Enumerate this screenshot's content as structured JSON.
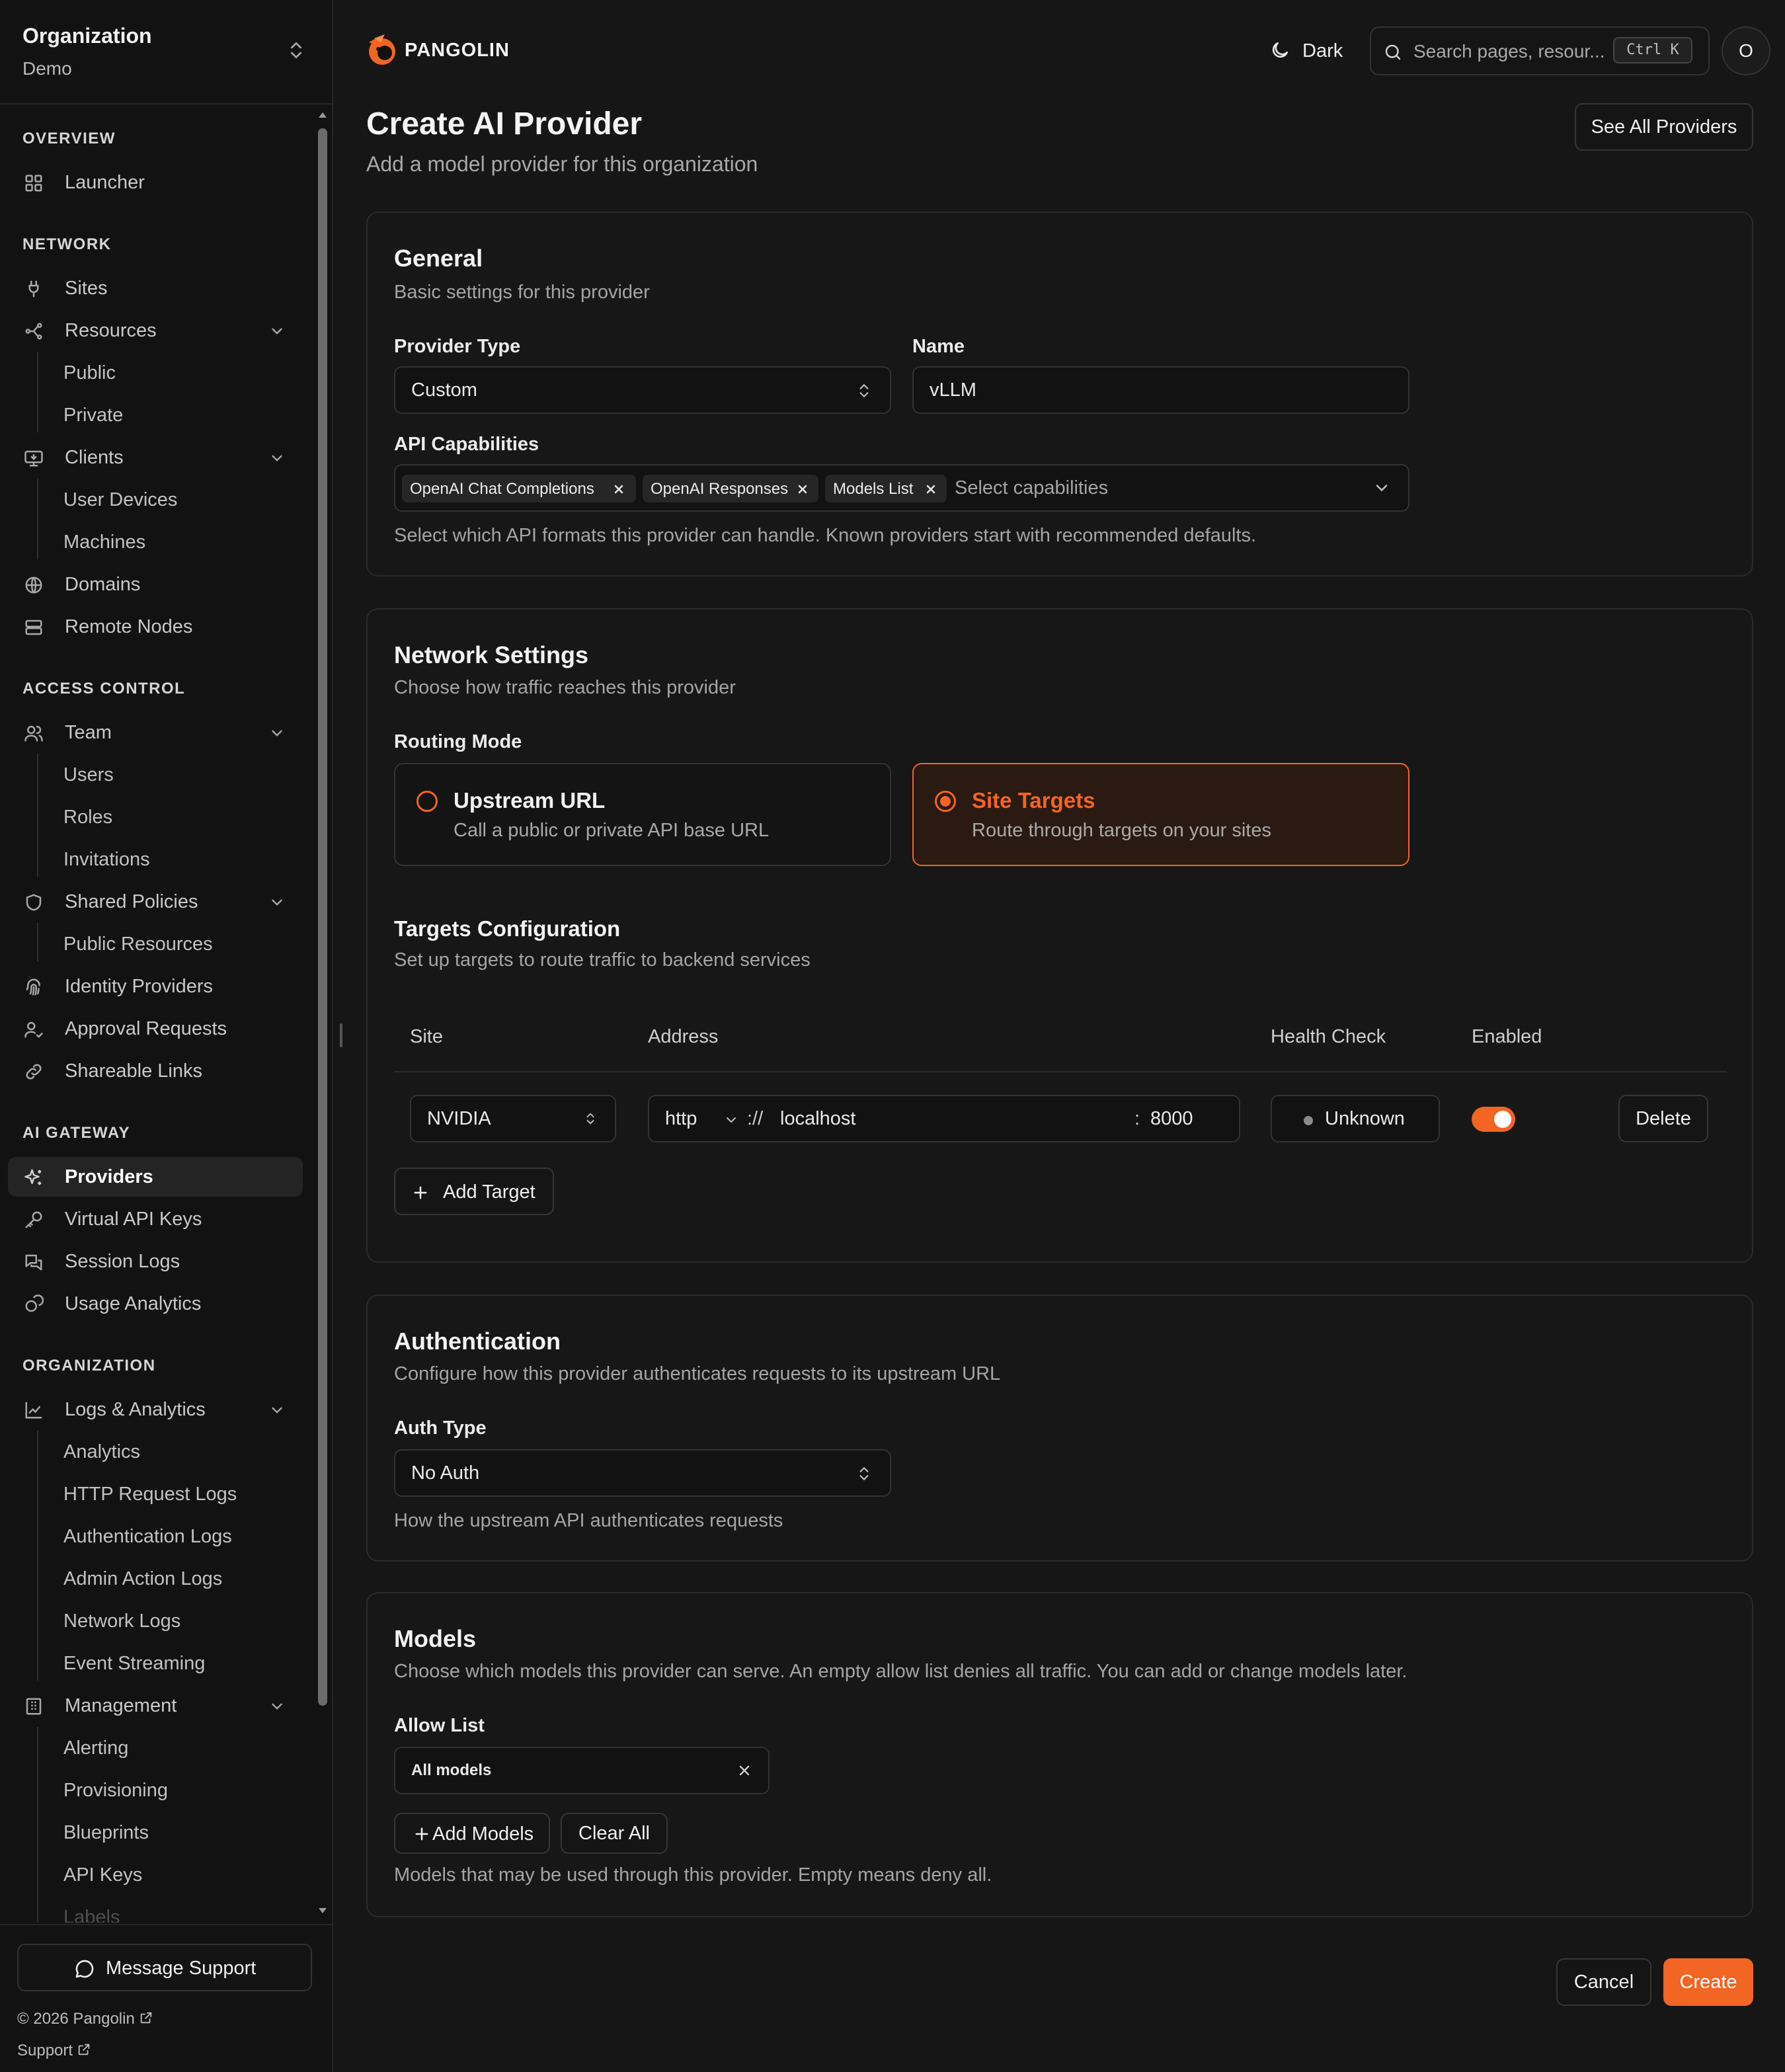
{
  "org": {
    "title": "Organization",
    "name": "Demo"
  },
  "nav": {
    "overview": "OVERVIEW",
    "launcher": "Launcher",
    "network": "NETWORK",
    "sites": "Sites",
    "resources": "Resources",
    "resources_public": "Public",
    "resources_private": "Private",
    "clients": "Clients",
    "clients_user_devices": "User Devices",
    "clients_machines": "Machines",
    "domains": "Domains",
    "remote_nodes": "Remote Nodes",
    "access_control": "ACCESS CONTROL",
    "team": "Team",
    "team_users": "Users",
    "team_roles": "Roles",
    "team_invitations": "Invitations",
    "shared_policies": "Shared Policies",
    "shared_public_resources": "Public Resources",
    "identity_providers": "Identity Providers",
    "approval_requests": "Approval Requests",
    "shareable_links": "Shareable Links",
    "ai_gateway": "AI GATEWAY",
    "providers": "Providers",
    "virtual_api_keys": "Virtual API Keys",
    "session_logs": "Session Logs",
    "usage_analytics": "Usage Analytics",
    "organization": "ORGANIZATION",
    "logs_analytics": "Logs & Analytics",
    "logs_analytics_analytics": "Analytics",
    "logs_http": "HTTP Request Logs",
    "logs_auth": "Authentication Logs",
    "logs_admin": "Admin Action Logs",
    "logs_network": "Network Logs",
    "logs_event_streaming": "Event Streaming",
    "management": "Management",
    "mgmt_alerting": "Alerting",
    "mgmt_provisioning": "Provisioning",
    "mgmt_blueprints": "Blueprints",
    "mgmt_api_keys": "API Keys",
    "mgmt_labels": "Labels"
  },
  "footer": {
    "message_support": "Message Support",
    "copyright": "© 2026 Pangolin",
    "support": "Support"
  },
  "topbar": {
    "brand": "PANGOLIN",
    "theme": "Dark",
    "search_placeholder": "Search pages, resour...",
    "search_shortcut": "Ctrl K",
    "avatar_initial": "O"
  },
  "page": {
    "title": "Create AI Provider",
    "subtitle": "Add a model provider for this organization",
    "see_all": "See All Providers"
  },
  "general": {
    "title": "General",
    "subtitle": "Basic settings for this provider",
    "provider_type_label": "Provider Type",
    "provider_type_value": "Custom",
    "name_label": "Name",
    "name_value": "vLLM",
    "capabilities_label": "API Capabilities",
    "capabilities": [
      "OpenAI Chat Completions",
      "OpenAI Responses",
      "Models List"
    ],
    "capabilities_placeholder": "Select capabilities",
    "capabilities_help": "Select which API formats this provider can handle. Known providers start with recommended defaults."
  },
  "network": {
    "title": "Network Settings",
    "subtitle": "Choose how traffic reaches this provider",
    "routing_label": "Routing Mode",
    "upstream_title": "Upstream URL",
    "upstream_desc": "Call a public or private API base URL",
    "site_title": "Site Targets",
    "site_desc": "Route through targets on your sites",
    "selected_mode": "Site Targets",
    "targets_title": "Targets Configuration",
    "targets_subtitle": "Set up targets to route traffic to backend services",
    "columns": {
      "site": "Site",
      "address": "Address",
      "health": "Health Check",
      "enabled": "Enabled"
    },
    "target": {
      "site": "NVIDIA",
      "scheme": "http",
      "separator": "://",
      "host": "localhost",
      "port_sep": ":",
      "port": "8000",
      "health": "Unknown",
      "enabled": true,
      "delete": "Delete"
    },
    "add_target": "Add Target"
  },
  "auth": {
    "title": "Authentication",
    "subtitle": "Configure how this provider authenticates requests to its upstream URL",
    "type_label": "Auth Type",
    "type_value": "No Auth",
    "help": "How the upstream API authenticates requests"
  },
  "models": {
    "title": "Models",
    "subtitle": "Choose which models this provider can serve. An empty allow list denies all traffic. You can add or change models later.",
    "allow_label": "Allow List",
    "allow_chip": "All models",
    "add_models": "Add Models",
    "clear_all": "Clear All",
    "help": "Models that may be used through this provider. Empty means deny all."
  },
  "actions": {
    "cancel": "Cancel",
    "create": "Create"
  },
  "colors": {
    "accent": "#f26522",
    "background": "#161616",
    "sidebar": "#121212"
  }
}
